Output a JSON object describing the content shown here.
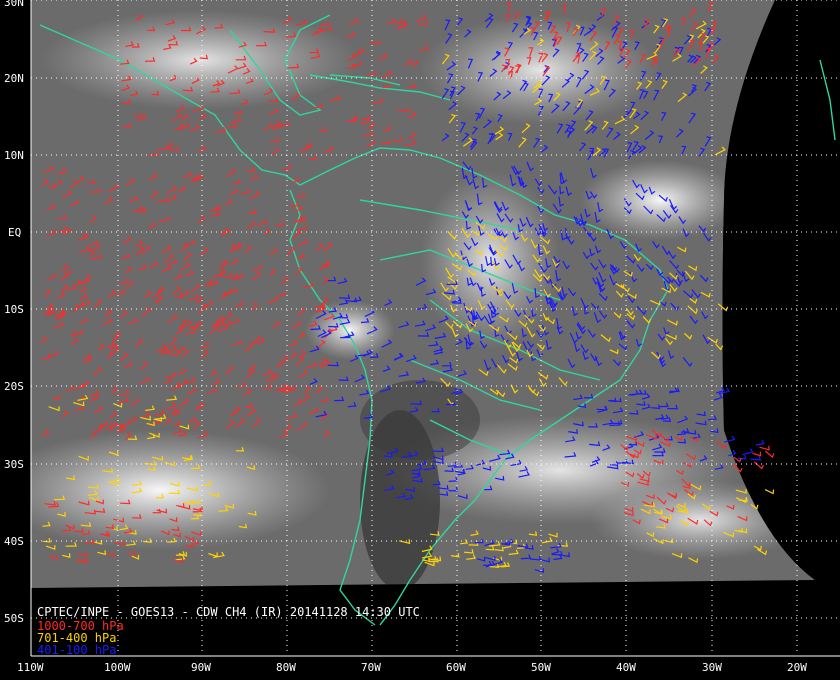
{
  "map": {
    "latitude_labels": [
      "30N",
      "20N",
      "10N",
      "EQ",
      "10S",
      "20S",
      "30S",
      "40S",
      "50S"
    ],
    "longitude_labels": [
      "110W",
      "100W",
      "90W",
      "80W",
      "70W",
      "60W",
      "50W",
      "40W",
      "30W",
      "20W"
    ],
    "title": "CPTEC/INPE - GOES13 - CDW CH4 (IR) 20141128 14:30 UTC",
    "legend": [
      {
        "label": "1000-700 hPa",
        "color": "#ff2a2a"
      },
      {
        "label": "701-400 hPa",
        "color": "#ffd200"
      },
      {
        "label": "401-100 hPa",
        "color": "#1a1aff"
      }
    ],
    "colors": {
      "coastline": "#2fd6a0",
      "grid": "#ffffff",
      "background": "#000000"
    }
  }
}
